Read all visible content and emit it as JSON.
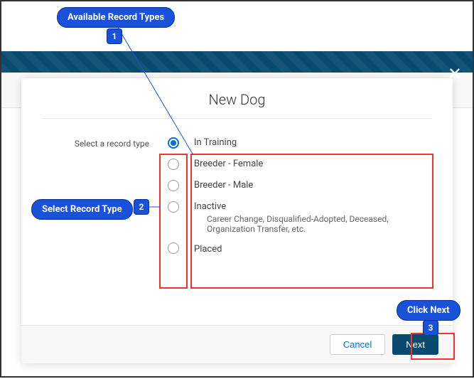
{
  "modal": {
    "title": "New Dog",
    "prompt": "Select a record type",
    "options": [
      {
        "label": "In Training",
        "sub": ""
      },
      {
        "label": "Breeder - Female",
        "sub": ""
      },
      {
        "label": "Breeder - Male",
        "sub": ""
      },
      {
        "label": "Inactive",
        "sub": "Career Change, Disqualified-Adopted, Deceased, Organization Transfer, etc."
      },
      {
        "label": "Placed",
        "sub": ""
      }
    ],
    "cancel": "Cancel",
    "next": "Next"
  },
  "annotations": {
    "a1": {
      "label": "Available Record Types",
      "num": "1"
    },
    "a2": {
      "label": "Select Record Type",
      "num": "2"
    },
    "a3": {
      "label": "Click Next",
      "num": "3"
    }
  }
}
